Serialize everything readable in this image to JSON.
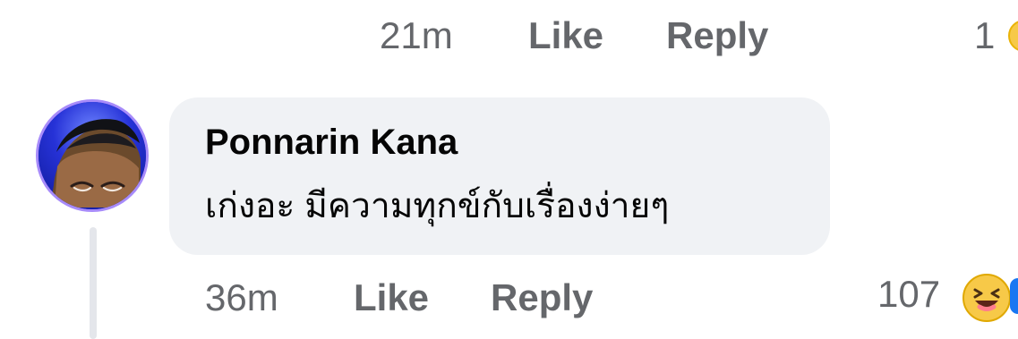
{
  "previous_comment": {
    "time": "21m",
    "like_label": "Like",
    "reply_label": "Reply",
    "reaction_count": "1"
  },
  "comment": {
    "author": "Ponnarin Kana",
    "text": "เก่งอะ มีความทุกข์กับเรื่องง่ายๆ",
    "time": "36m",
    "like_label": "Like",
    "reply_label": "Reply",
    "reaction_count": "107"
  },
  "icons": {
    "reaction_top": "haha-reaction-icon",
    "reaction_bottom_primary": "haha-reaction-icon",
    "reaction_bottom_secondary": "like-reaction-icon"
  },
  "colors": {
    "meta_text": "#65676b",
    "bubble_bg": "#f0f2f5",
    "thread_line": "#e4e6eb",
    "avatar_bg": "#1d28c9",
    "reaction_yellow": "#f7c948",
    "reaction_blue": "#1877f2"
  }
}
